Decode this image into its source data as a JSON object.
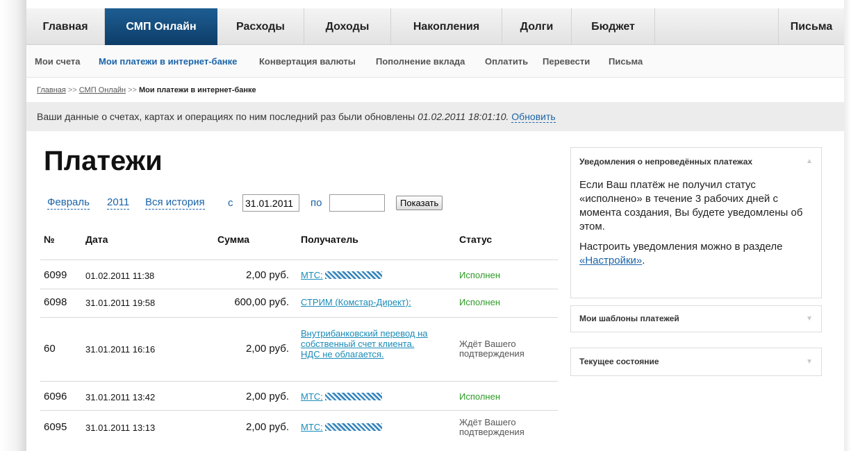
{
  "nav": {
    "tabs": [
      {
        "label": "Главная"
      },
      {
        "label": "СМП Онлайн"
      },
      {
        "label": "Расходы"
      },
      {
        "label": "Доходы"
      },
      {
        "label": "Накопления"
      },
      {
        "label": "Долги"
      },
      {
        "label": "Бюджет"
      }
    ],
    "right_tab": "Письма",
    "active_tab": "СМП Онлайн",
    "active_color": "#174f80"
  },
  "subnav": {
    "items": [
      {
        "label": "Мои счета"
      },
      {
        "label": "Мои платежи в интернет-банке"
      },
      {
        "label": "Конвертация валюты"
      },
      {
        "label": "Пополнение вклада"
      },
      {
        "label": "Оплатить"
      },
      {
        "label": "Перевести"
      },
      {
        "label": "Письма"
      }
    ],
    "active_item": "Мои платежи в интернет-банке"
  },
  "breadcrumb": {
    "items": [
      "Главная",
      "СМП Онлайн"
    ],
    "separator": ">>",
    "current": "Мои платежи в интернет-банке"
  },
  "info": {
    "text": "Ваши данные о счетах, картах и операциях по ним последний раз были обновлены",
    "timestamp": "01.02.2011 18:01:10.",
    "refresh_label": "Обновить"
  },
  "page_title": "Платежи",
  "filters": {
    "month": "Февраль",
    "year": "2011",
    "all_history": "Вся история",
    "from_label": "с",
    "from_value": "31.01.2011",
    "to_label": "по",
    "to_value": "",
    "show_button": "Показать"
  },
  "table": {
    "headers": {
      "num": "№",
      "date": "Дата",
      "sum": "Сумма",
      "recipient": "Получатель",
      "status": "Статус"
    },
    "rows": [
      {
        "num": "6099",
        "date": "01.02.2011 11:38",
        "sum": "2,00 руб.",
        "recipient": "МТС:",
        "masked": true,
        "status": "Исполнен",
        "status_type": "done"
      },
      {
        "num": "6098",
        "date": "31.01.2011 19:58",
        "sum": "600,00 руб.",
        "recipient": "СТРИМ (Комстар-Директ):",
        "masked": false,
        "status": "Исполнен",
        "status_type": "done"
      },
      {
        "num": "60",
        "date": "31.01.2011 16:16",
        "sum": "2,00 руб.",
        "recipient": "Внутрибанковский перевод на собственный счет клиента. НДС не облагается.",
        "masked": false,
        "status": "Ждёт Вашего подтверждения",
        "status_type": "waiting"
      },
      {
        "num": "6096",
        "date": "31.01.2011 13:42",
        "sum": "2,00 руб.",
        "recipient": "МТС:",
        "masked": true,
        "status": "Исполнен",
        "status_type": "done"
      },
      {
        "num": "6095",
        "date": "31.01.2011 13:13",
        "sum": "2,00 руб.",
        "recipient": "МТС:",
        "masked": true,
        "status": "Ждёт Вашего подтверждения",
        "status_type": "waiting"
      }
    ],
    "status_colors": {
      "done": "#2e9a27",
      "waiting": "#555555"
    }
  },
  "sidebar": {
    "notifications": {
      "title": "Уведомления о непроведённых платежах",
      "body": "Если Ваш платёж не получил статус «исполнено» в течение 3 рабочих дней с момента создания, Вы будете уведомлены об этом.",
      "settings_text": "Настроить уведомления можно в разделе",
      "settings_link": "«Настройки»",
      "settings_tail": "."
    },
    "templates_title": "Мои шаблоны платежей",
    "state_title": "Текущее состояние"
  }
}
